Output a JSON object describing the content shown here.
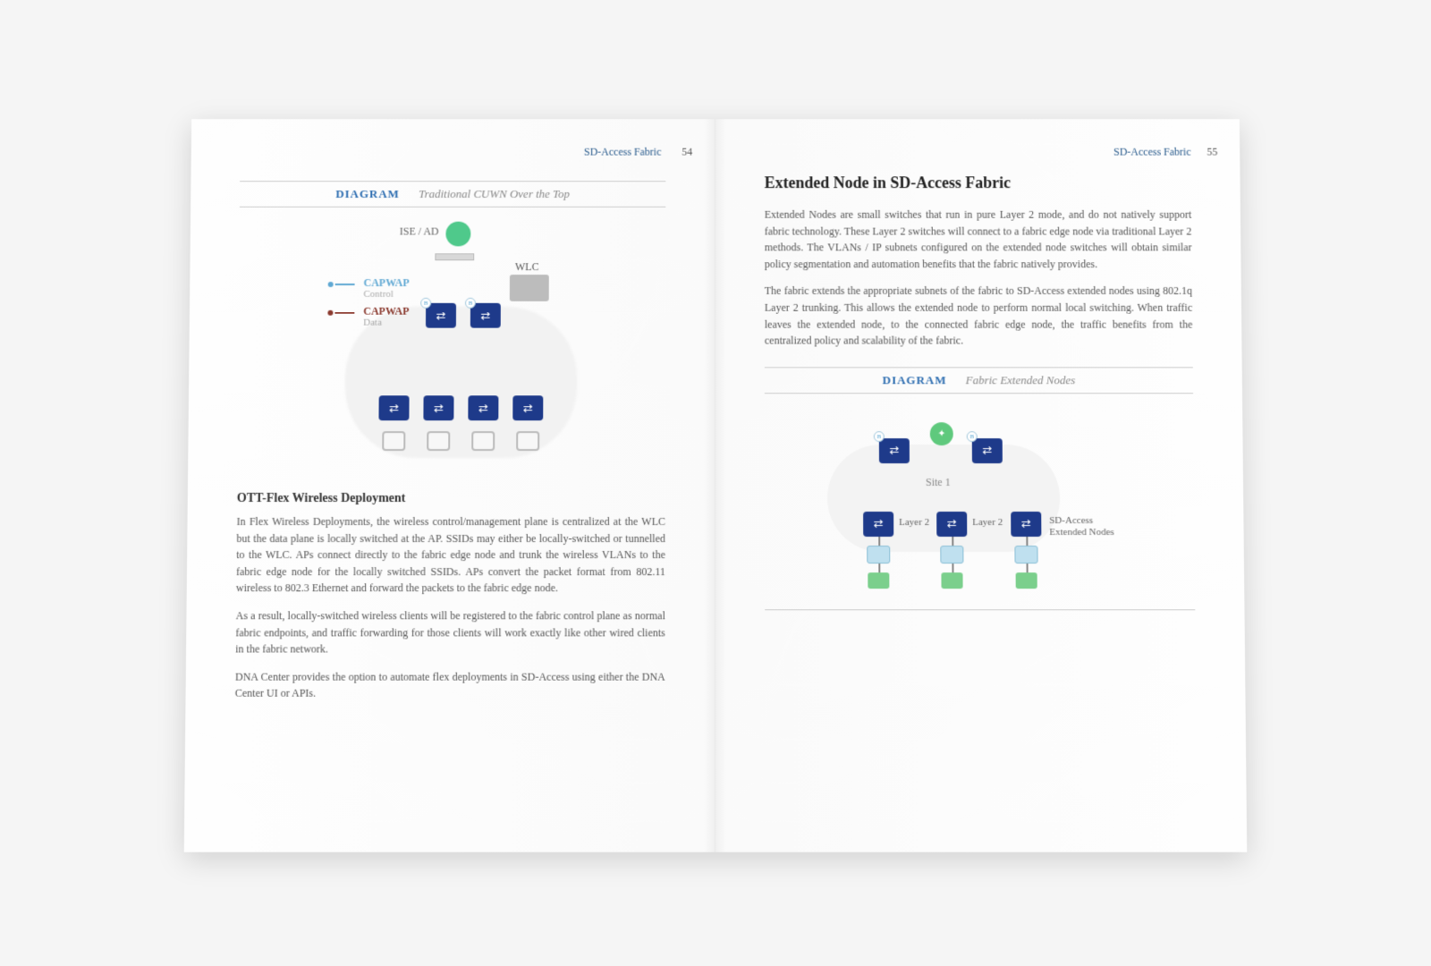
{
  "left": {
    "running_header": "SD-Access Fabric",
    "page_number": "54",
    "diagram_label": "DIAGRAM",
    "diagram_subtitle": "Traditional CUWN Over the Top",
    "ise_label": "ISE / AD",
    "wlc_label": "WLC",
    "capwap_control": "CAPWAP",
    "capwap_control_sub": "Control",
    "capwap_data": "CAPWAP",
    "capwap_data_sub": "Data",
    "section_title": "OTT-Flex Wireless Deployment",
    "para1": "In Flex Wireless Deployments, the wireless control/management plane is centralized at the WLC but the data plane is locally switched at the AP. SSIDs may either be locally-switched or tunnelled to the WLC. APs connect directly to the fabric edge node and trunk the wireless VLANs to the fabric edge node for the locally switched SSIDs. APs convert the packet format from 802.11 wireless to 802.3 Ethernet and forward the packets to the fabric edge node.",
    "para2": "As a result, locally-switched wireless clients will be registered to the fabric control plane as normal fabric endpoints, and traffic forwarding for those clients will work exactly like other wired clients in the fabric network.",
    "para3": "DNA Center provides the option to automate flex deployments in SD-Access using either the DNA Center UI or APIs."
  },
  "right": {
    "running_header": "SD-Access Fabric",
    "page_number": "55",
    "heading": "Extended Node in SD-Access Fabric",
    "para1": "Extended Nodes are small switches that run in pure Layer 2 mode, and do not natively support fabric technology. These Layer 2 switches will connect to a fabric edge node via traditional Layer 2 methods. The VLANs / IP subnets configured on the extended node switches will obtain similar policy segmentation and automation benefits that the fabric natively provides.",
    "para2": "The fabric extends the appropriate subnets of the fabric to SD-Access extended nodes using 802.1q Layer 2 trunking. This allows the extended node to perform normal local switching. When traffic leaves the extended node, to the connected fabric edge node, the traffic benefits from the centralized policy and scalability of the fabric.",
    "diagram_label": "DIAGRAM",
    "diagram_subtitle": "Fabric Extended Nodes",
    "site_label": "Site 1",
    "l2_label_a": "Layer 2",
    "l2_label_b": "Layer 2",
    "ext_label": "SD-Access Extended Nodes"
  }
}
